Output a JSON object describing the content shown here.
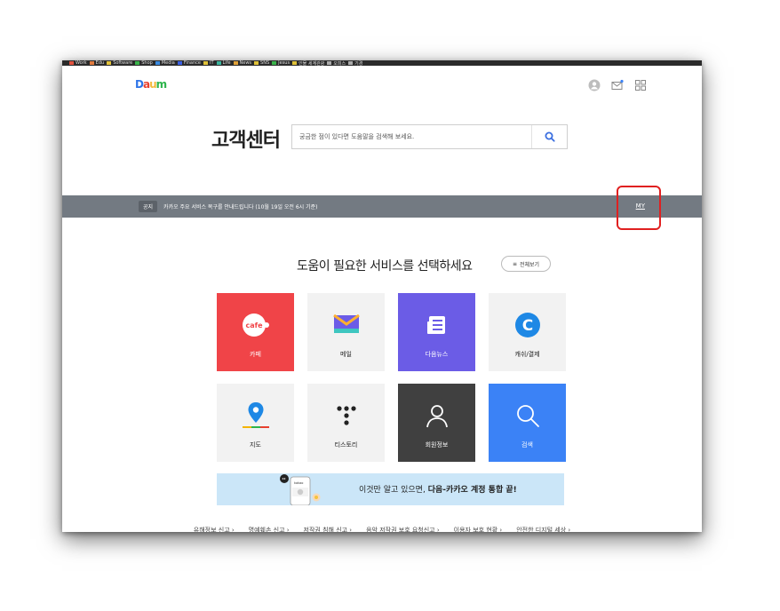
{
  "bookmarks": [
    {
      "label": "Work",
      "color": "#e0523e"
    },
    {
      "label": "Edu",
      "color": "#e07a3e"
    },
    {
      "label": "Software",
      "color": "#e2c23a"
    },
    {
      "label": "Shop",
      "color": "#3ab34a"
    },
    {
      "label": "Media",
      "color": "#3a8ae0"
    },
    {
      "label": "Finance",
      "color": "#3a5ee0"
    },
    {
      "label": "IT",
      "color": "#e0c23a"
    },
    {
      "label": "Life",
      "color": "#3ab39c"
    },
    {
      "label": "News",
      "color": "#e0a23a"
    },
    {
      "label": "SNS",
      "color": "#e0c23a"
    },
    {
      "label": "Jesus",
      "color": "#3ab34a"
    },
    {
      "label": "인물 세계관광",
      "color": "#e0c23a"
    },
    {
      "label": "오피스",
      "color": "#aaaaaa"
    },
    {
      "label": "기경",
      "color": "#aaaaaa"
    }
  ],
  "header": {
    "logo": "Daum"
  },
  "hero": {
    "title": "고객센터",
    "search_placeholder": "궁금한 점이 있다면 도움말을 검색해 보세요."
  },
  "notice": {
    "tag": "공지",
    "text": "카카오 주요 서비스 복구를 안내드립니다 (10월 19일 오전 6시 기준)",
    "my_link": "MY"
  },
  "services": {
    "title": "도움이 필요한 서비스를 선택하세요",
    "all_button": "전체보기",
    "tiles": [
      {
        "label": "카페",
        "icon": "cafe-icon",
        "bg": "#f04448",
        "fg": "#ffffff"
      },
      {
        "label": "메일",
        "icon": "mail-icon",
        "bg": "#f2f2f2",
        "fg": "#222222"
      },
      {
        "label": "다음뉴스",
        "icon": "news-icon",
        "bg": "#6b5ce6",
        "fg": "#ffffff"
      },
      {
        "label": "캐쉬/결제",
        "icon": "cash-icon",
        "bg": "#f2f2f2",
        "fg": "#222222"
      },
      {
        "label": "지도",
        "icon": "map-pin-icon",
        "bg": "#f2f2f2",
        "fg": "#222222"
      },
      {
        "label": "티스토리",
        "icon": "tistory-icon",
        "bg": "#f2f2f2",
        "fg": "#222222"
      },
      {
        "label": "회원정보",
        "icon": "user-icon",
        "bg": "#404040",
        "fg": "#ffffff"
      },
      {
        "label": "검색",
        "icon": "search-icon",
        "bg": "#3b82f6",
        "fg": "#ffffff"
      }
    ]
  },
  "banner": {
    "text_plain": "이것만 알고 있으면,",
    "text_bold": "다음-카카오 계정 통합 끝!"
  },
  "footer": {
    "links": [
      "유해정보 신고 ›",
      "명예훼손 신고 ›",
      "저작권 침해 신고 ›",
      "음악 저작권 보호 요청신고 ›",
      "이용자 보호 현황 ›",
      "안전한 디지털 세상 ›"
    ]
  }
}
